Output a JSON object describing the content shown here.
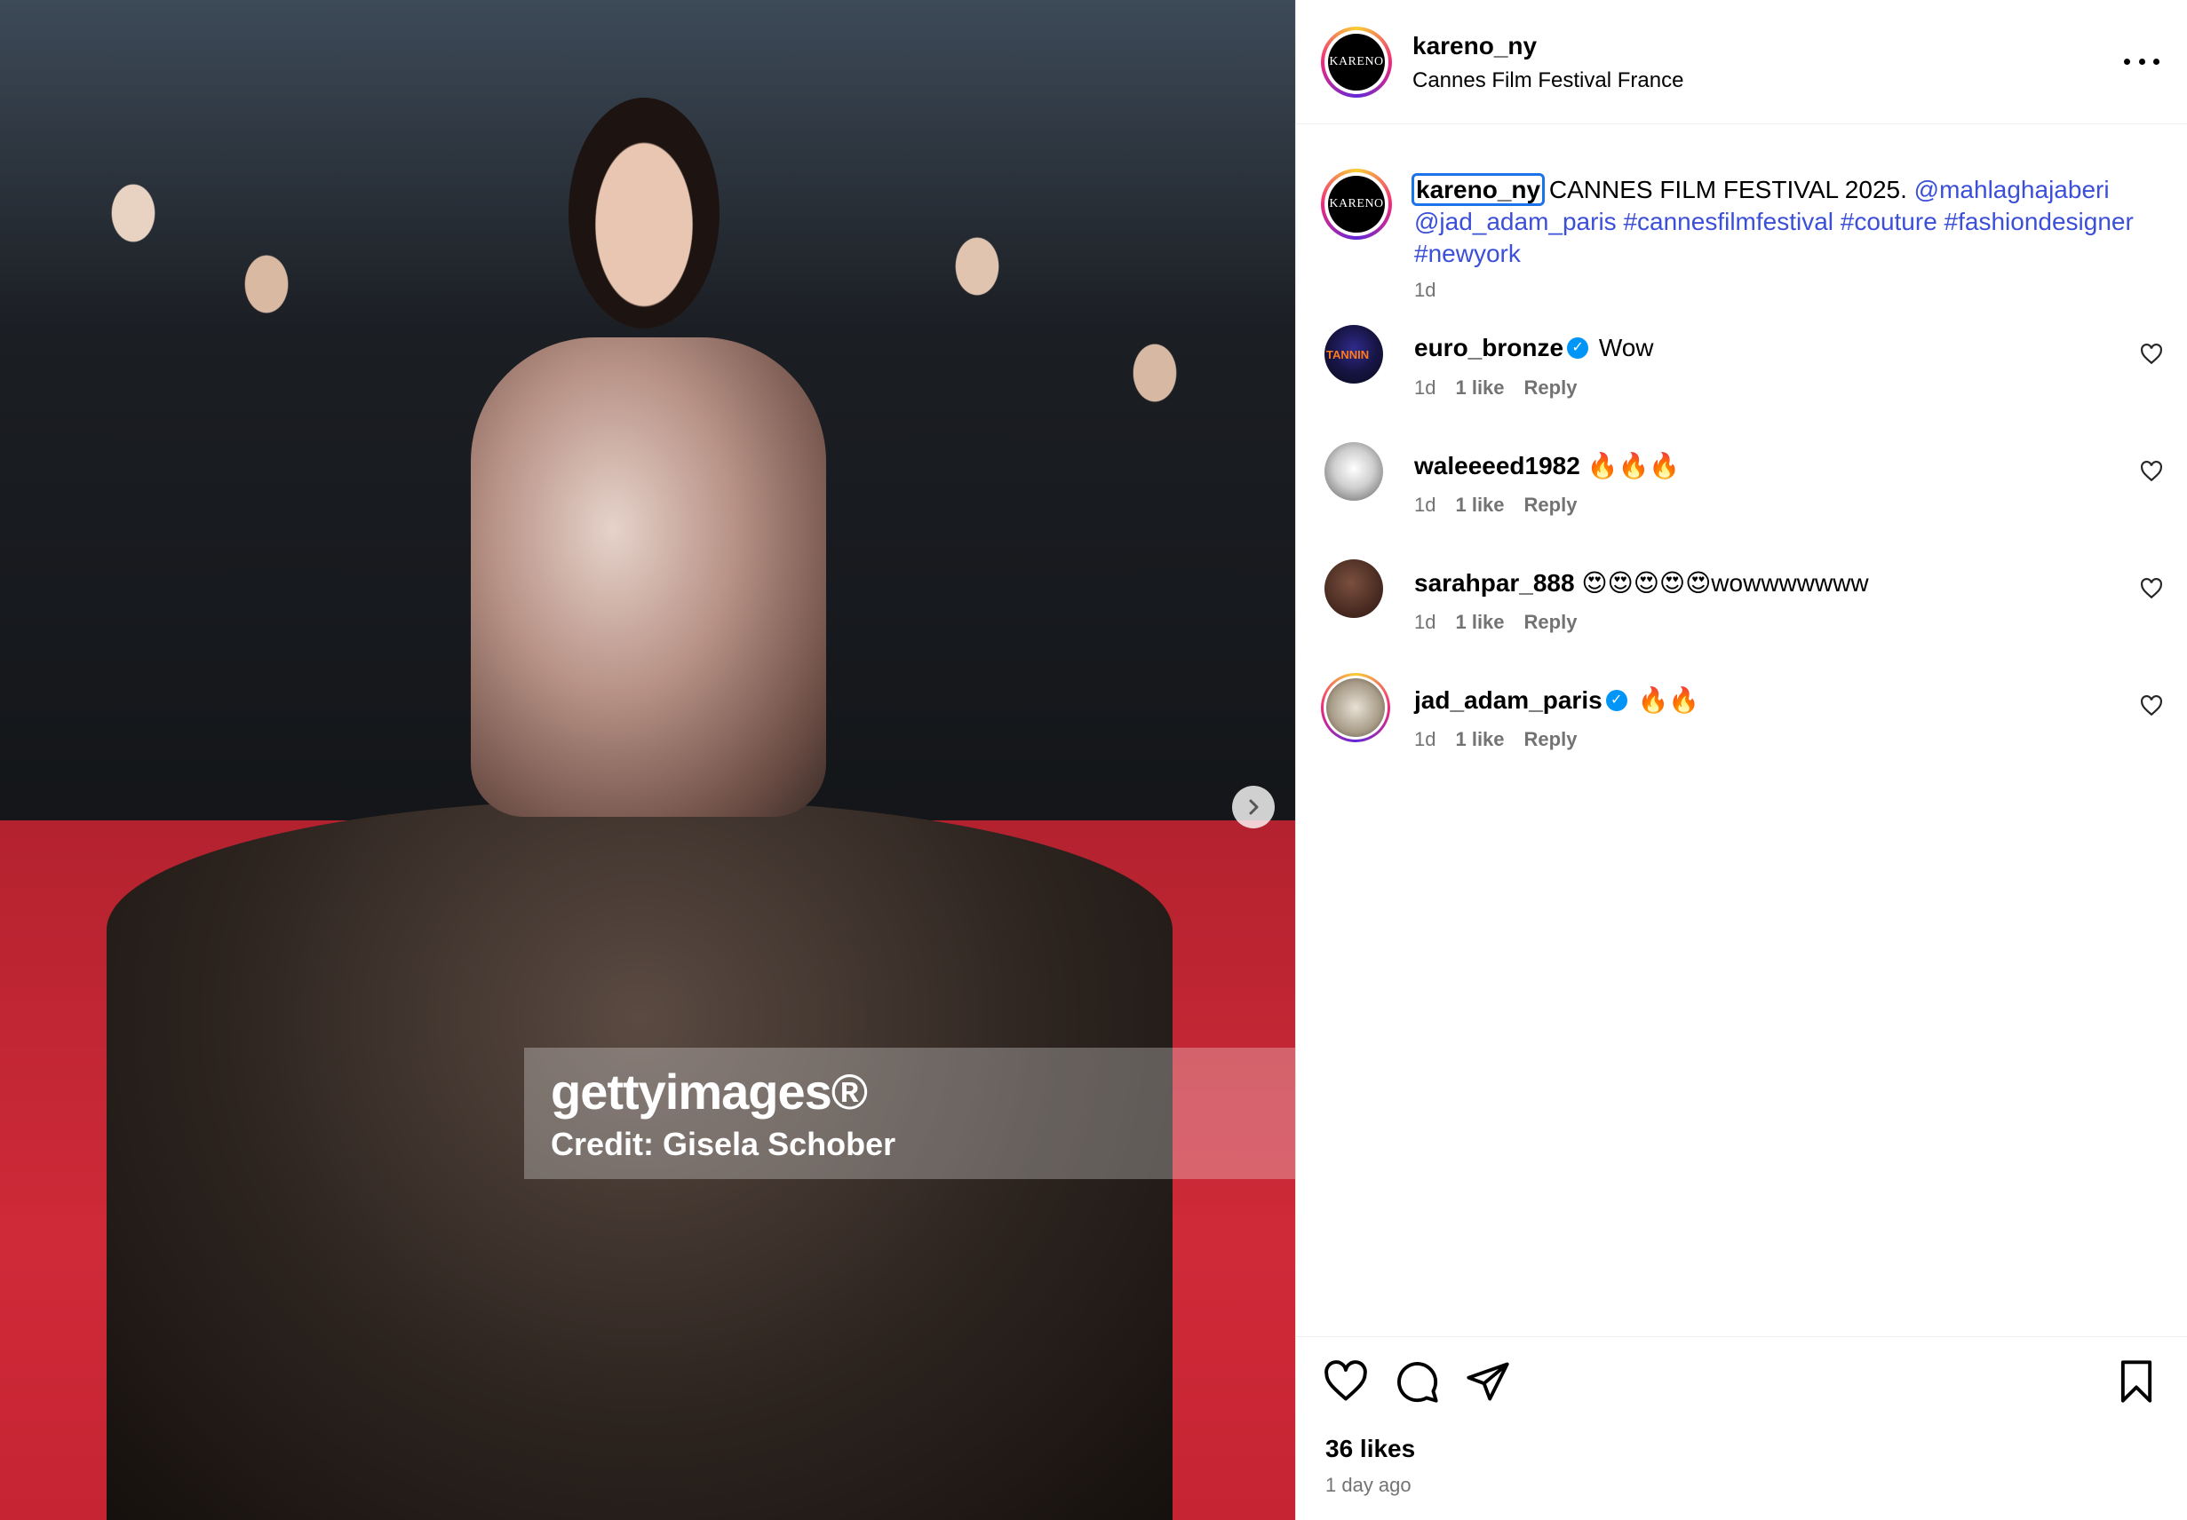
{
  "post": {
    "username": "kareno_ny",
    "location": "Cannes Film Festival France",
    "avatar_text": "KARENO",
    "media": {
      "watermark_brand": "gettyimages®",
      "watermark_credit": "Credit: Gisela Schober"
    },
    "caption": {
      "username": "kareno_ny",
      "text": "CANNES FILM FESTIVAL 2025.",
      "mentions": [
        "@mahlaghajaberi",
        "@jad_adam_paris"
      ],
      "hashtags": [
        "#cannesfilmfestival",
        "#couture",
        "#fashiondesigner",
        "#newyork"
      ],
      "time": "1d"
    },
    "comments": [
      {
        "user": "euro_bronze",
        "verified": true,
        "text": "Wow",
        "time": "1d",
        "likes": "1 like",
        "reply": "Reply"
      },
      {
        "user": "waleeeed1982",
        "verified": false,
        "text": "🔥🔥🔥",
        "time": "1d",
        "likes": "1 like",
        "reply": "Reply"
      },
      {
        "user": "sarahpar_888",
        "verified": false,
        "text": "😍😍😍😍😍wowwwwwww",
        "time": "1d",
        "likes": "1 like",
        "reply": "Reply"
      },
      {
        "user": "jad_adam_paris",
        "verified": true,
        "text": "🔥🔥",
        "time": "1d",
        "likes": "1 like",
        "reply": "Reply"
      }
    ],
    "likes": "36 likes",
    "posted_ago": "1 day ago"
  },
  "icons": [
    "more-options-icon",
    "next-arrow-icon",
    "verified-icon",
    "heart-icon",
    "comment-icon",
    "share-icon",
    "bookmark-icon"
  ],
  "colors": {
    "link": "#3b4fd8",
    "muted": "#737373",
    "verified": "#0095f6",
    "focus_outline": "#1a73e8"
  }
}
